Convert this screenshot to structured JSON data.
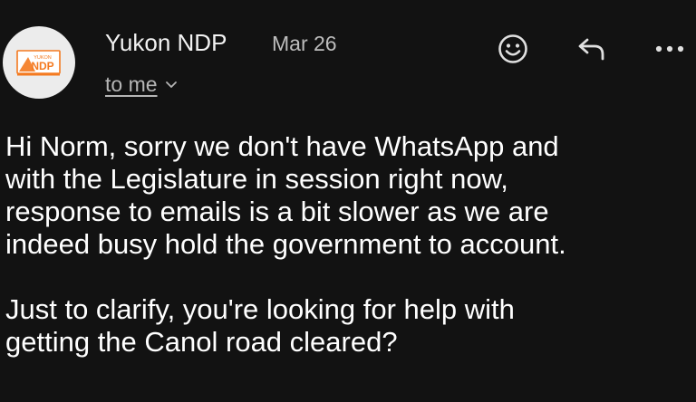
{
  "header": {
    "sender_name": "Yukon NDP",
    "date": "Mar 26",
    "recipient_label": "to me",
    "avatar": {
      "logo_small_text": "YUKON",
      "logo_text": "NDP",
      "logo_color": "#f47a20",
      "background_color": "#ececec"
    },
    "icons": [
      "emoji-reaction-icon",
      "reply-icon",
      "more-options-icon",
      "chevron-down-icon"
    ]
  },
  "message": {
    "paragraphs": [
      [
        "Hi Norm, sorry we don't have WhatsApp and",
        "with the Legislature in session right now,",
        "response to emails is a bit slower as we are",
        "indeed busy hold the government to account."
      ],
      [
        "Just to clarify, you're looking for help with",
        "getting the Canol road cleared?"
      ]
    ]
  },
  "colors": {
    "background": "#121212",
    "text_primary": "#ffffff",
    "text_secondary": "#bdbdbd"
  }
}
